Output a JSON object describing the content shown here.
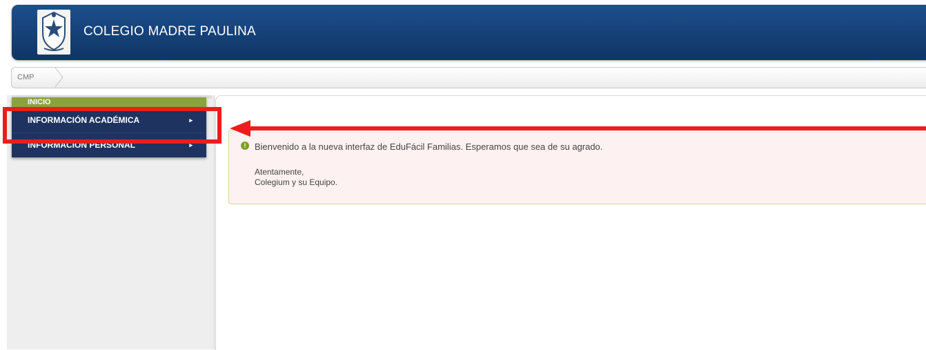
{
  "header": {
    "title": "COLEGIO MADRE PAULINA",
    "accent": "#163f76"
  },
  "breadcrumb": {
    "items": [
      "CMP"
    ]
  },
  "sidebar": {
    "items": [
      {
        "label": "INICIO",
        "color": "#8aa33c"
      },
      {
        "label": "INFORMACIÓN ACADÉMICA",
        "arrow": "▸",
        "color": "#1e3360"
      },
      {
        "label": "INFORMACIÓN PERSONAL",
        "arrow": "▸",
        "color": "#1e3360"
      }
    ]
  },
  "alert": {
    "icon": "info-icon",
    "message": "Bienvenido a la nueva interfaz de EduFácil Familias. Esperamos que sea de su agrado.",
    "sign_line1": "Atentamente,",
    "sign_line2": "Colegium y su Equipo."
  },
  "annotation": {
    "color": "#ee1c1c"
  }
}
